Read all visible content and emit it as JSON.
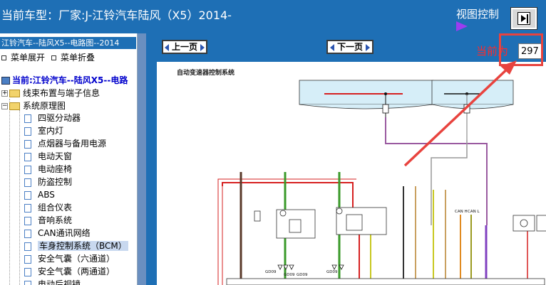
{
  "header": {
    "title": "当前车型：厂家:J-江铃汽车陆风（X5）2014-",
    "view_control_label": "视图控制"
  },
  "left_panel": {
    "title": "江铃汽车--陆风X5--电路图--2014",
    "expand_label": "菜单展开",
    "collapse_label": "菜单折叠",
    "tree_root": "当前:江铃汽车--陆风X5--电路",
    "folders": [
      "线束布置与端子信息",
      "系统原理图"
    ],
    "items": [
      "四驱分动器",
      "室内灯",
      "点烟器与备用电源",
      "电动天窗",
      "电动座椅",
      "防盗控制",
      "ABS",
      "组合仪表",
      "音响系统",
      "CAN通讯网络",
      "车身控制系统（BCM）",
      "安全气囊（六通道）",
      "安全气囊（两通道）",
      "电动后视镜"
    ],
    "selected_index": 10
  },
  "nav": {
    "prev_label": "上一页",
    "next_label": "下一页",
    "current_label": "当前为",
    "page_value": "297"
  },
  "diagram": {
    "title": "自动变速器控制系统",
    "connectors": [
      "GD09",
      "GD09",
      "GD09",
      "GD09"
    ],
    "labels": [
      "CAN H",
      "CAN L"
    ]
  },
  "colors": {
    "header_blue": "#1e6fb5",
    "highlight_red": "#e8433e",
    "current_label_red": "#ff2a2a"
  }
}
